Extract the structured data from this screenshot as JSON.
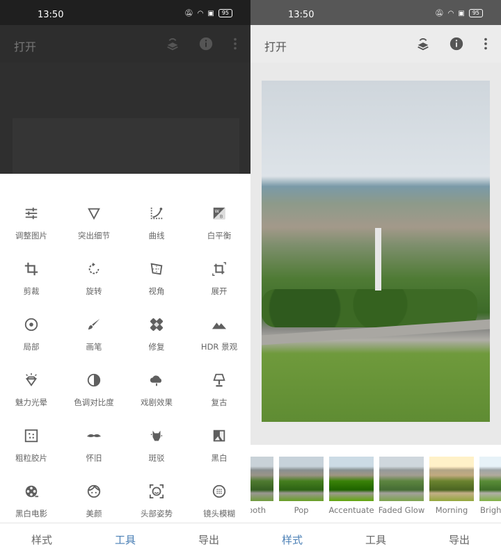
{
  "status": {
    "time": "13:50",
    "battery": "95"
  },
  "left": {
    "appbar": {
      "open_label": "打开"
    },
    "tools": [
      {
        "label": "调整图片",
        "icon": "tune-icon"
      },
      {
        "label": "突出细节",
        "icon": "triangle-icon"
      },
      {
        "label": "曲线",
        "icon": "curves-icon"
      },
      {
        "label": "白平衡",
        "icon": "white-balance-icon"
      },
      {
        "label": "剪裁",
        "icon": "crop-icon"
      },
      {
        "label": "旋转",
        "icon": "rotate-icon"
      },
      {
        "label": "视角",
        "icon": "perspective-icon"
      },
      {
        "label": "展开",
        "icon": "expand-icon"
      },
      {
        "label": "局部",
        "icon": "selective-icon"
      },
      {
        "label": "画笔",
        "icon": "brush-icon"
      },
      {
        "label": "修复",
        "icon": "healing-icon"
      },
      {
        "label": "HDR 景观",
        "icon": "mountains-icon"
      },
      {
        "label": "魅力光晕",
        "icon": "diamond-icon"
      },
      {
        "label": "色调对比度",
        "icon": "contrast-icon"
      },
      {
        "label": "戏剧效果",
        "icon": "cloud-icon"
      },
      {
        "label": "复古",
        "icon": "lamp-icon"
      },
      {
        "label": "粗粒胶片",
        "icon": "grain-icon"
      },
      {
        "label": "怀旧",
        "icon": "mustache-icon"
      },
      {
        "label": "斑驳",
        "icon": "grunge-icon"
      },
      {
        "label": "黑白",
        "icon": "black-white-icon"
      },
      {
        "label": "黑白电影",
        "icon": "film-reel-icon"
      },
      {
        "label": "美颜",
        "icon": "face-icon"
      },
      {
        "label": "头部姿势",
        "icon": "face-pose-icon"
      },
      {
        "label": "镜头模糊",
        "icon": "lens-blur-icon"
      }
    ],
    "nav": [
      "样式",
      "工具",
      "导出"
    ],
    "active_nav": "工具"
  },
  "right": {
    "appbar": {
      "open_label": "打开"
    },
    "filters": [
      "Smooth",
      "Pop",
      "Accentuate",
      "Faded Glow",
      "Morning",
      "Bright"
    ],
    "filter_visible_text": [
      "ooth",
      "Pop",
      "Accentuate",
      "Faded Glow",
      "Morning",
      "Bri"
    ],
    "nav": [
      "样式",
      "工具",
      "导出"
    ],
    "active_nav": "样式"
  },
  "colors": {
    "accent": "#4a7fb5",
    "icon": "#5f5f5f"
  }
}
